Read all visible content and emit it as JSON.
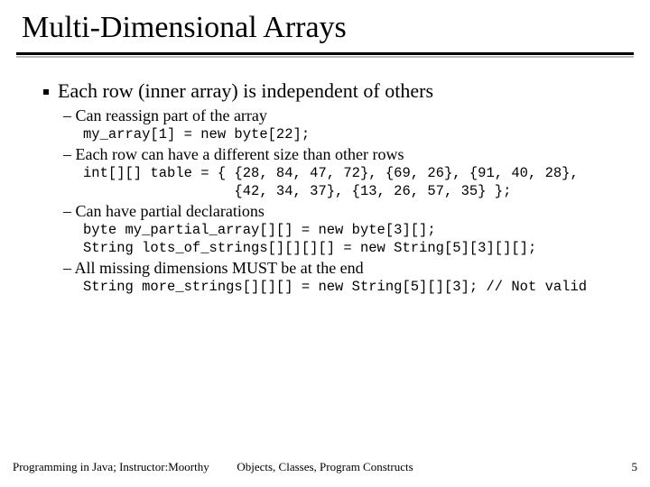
{
  "title": "Multi-Dimensional Arrays",
  "bullet": "Each row (inner array) is independent of others",
  "subs": [
    {
      "text": "Can reassign part of the array",
      "code": "my_array[1] = new byte[22];"
    },
    {
      "text": "Each row can have a different size than other rows",
      "code": "int[][] table = { {28, 84, 47, 72}, {69, 26}, {91, 40, 28},\n                  {42, 34, 37}, {13, 26, 57, 35} };"
    },
    {
      "text": "Can have partial declarations",
      "code": "byte my_partial_array[][] = new byte[3][];\nString lots_of_strings[][][][] = new String[5][3][][];"
    },
    {
      "text": "All missing dimensions MUST be at the end",
      "code": "String more_strings[][][] = new String[5][][3]; // Not valid"
    }
  ],
  "footer": {
    "left": "Programming in Java; Instructor:Moorthy",
    "center": "Objects, Classes, Program Constructs",
    "right": "5"
  }
}
